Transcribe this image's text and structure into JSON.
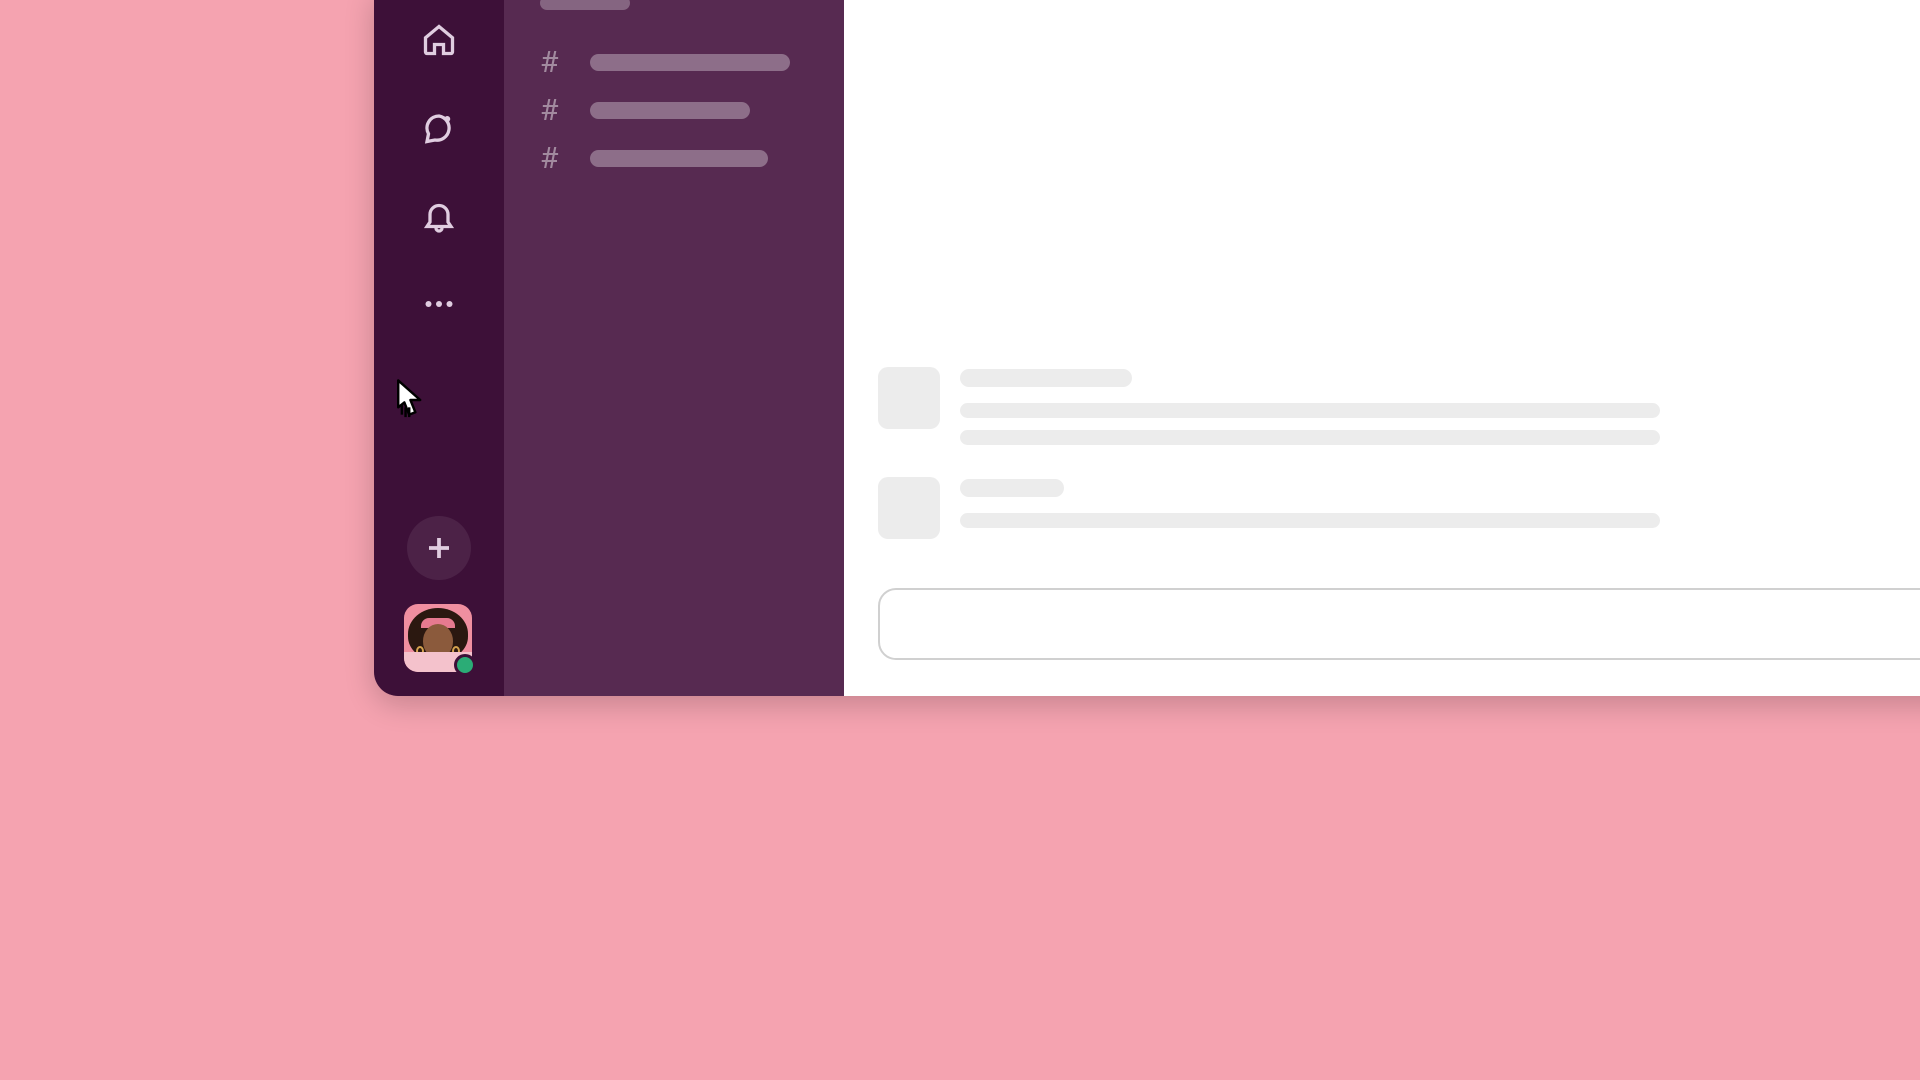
{
  "colors": {
    "page_bg": "#f5a3b0",
    "rail_bg": "#3d1038",
    "sidebar_bg": "#572a51",
    "main_bg": "#ffffff",
    "placeholder_light": "#ececec",
    "placeholder_purple": "rgba(255,255,255,0.32)",
    "presence_online": "#2bac76"
  },
  "rail": {
    "icons": [
      "home-icon",
      "dm-icon",
      "notifications-icon",
      "more-icon"
    ],
    "plus_label": "Create new",
    "user_status": "online"
  },
  "sidebar": {
    "header_placeholder_width": 90,
    "channels": [
      {
        "prefix": "#",
        "placeholder_width": 200
      },
      {
        "prefix": "#",
        "placeholder_width": 160
      },
      {
        "prefix": "#",
        "placeholder_width": 178
      }
    ]
  },
  "main": {
    "messages": [
      {
        "name_width": 172,
        "lines": [
          700,
          700
        ]
      },
      {
        "name_width": 104,
        "lines": [
          700
        ]
      }
    ],
    "composer_placeholder": ""
  }
}
